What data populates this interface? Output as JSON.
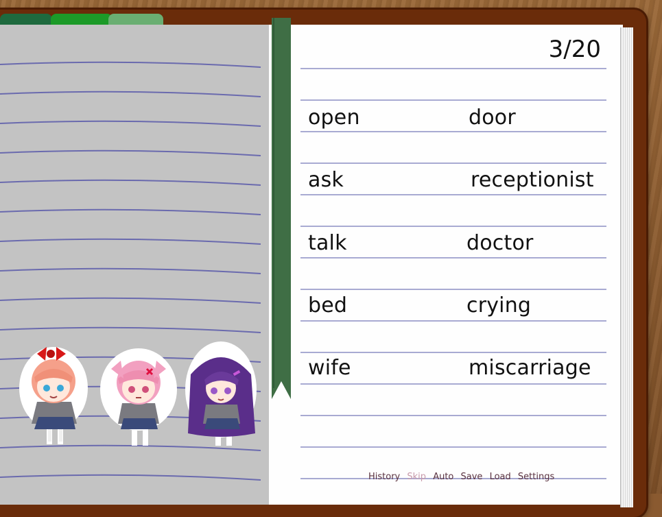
{
  "counter": "3/20",
  "words": [
    {
      "left": "open",
      "right": "door"
    },
    {
      "left": "ask",
      "right": "receptionist"
    },
    {
      "left": "talk",
      "right": "doctor"
    },
    {
      "left": "bed",
      "right": "crying"
    },
    {
      "left": "wife",
      "right": "miscarriage"
    }
  ],
  "quick_menu": {
    "history": "History",
    "skip": "Skip",
    "auto": "Auto",
    "save": "Save",
    "load": "Load",
    "settings": "Settings"
  },
  "colors": {
    "sayori": "#f5a08a",
    "natsuki": "#f2a0c0",
    "yuri": "#6a3a9a",
    "ribbon": "#3f6e45",
    "ruling": "#a8aad2"
  }
}
